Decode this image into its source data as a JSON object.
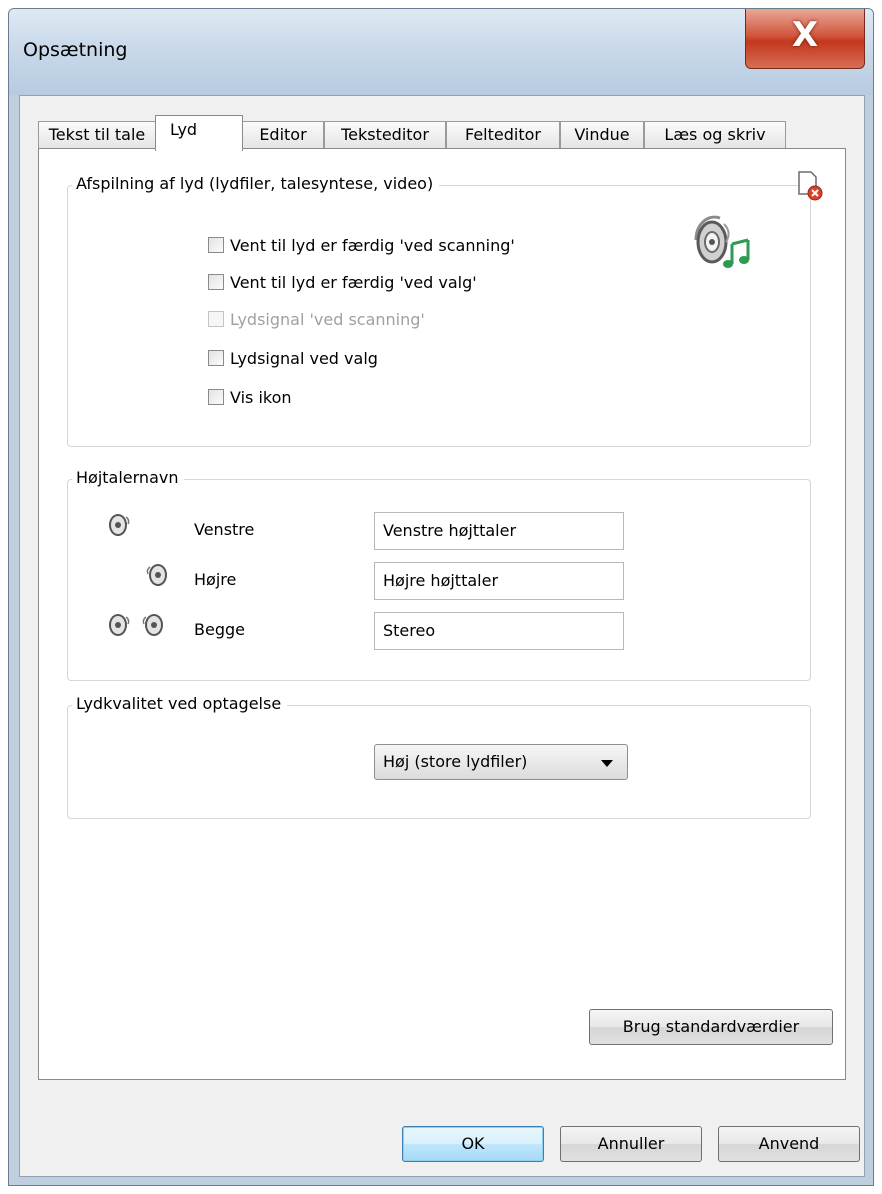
{
  "window": {
    "title": "Opsætning",
    "close_label": "X"
  },
  "tabs": [
    {
      "label": "Tekst til tale",
      "active": false
    },
    {
      "label": "Lyd",
      "active": true
    },
    {
      "label": "Editor",
      "active": false
    },
    {
      "label": "Teksteditor",
      "active": false
    },
    {
      "label": "Felteditor",
      "active": false
    },
    {
      "label": "Vindue",
      "active": false
    },
    {
      "label": "Læs og skriv",
      "active": false
    }
  ],
  "playback": {
    "title": "Afspilning af lyd (lydfiler, talesyntese, video)",
    "options": [
      {
        "label": "Vent til lyd er færdig 'ved scanning'",
        "checked": false,
        "enabled": true
      },
      {
        "label": "Vent til lyd er færdig 'ved valg'",
        "checked": false,
        "enabled": true
      },
      {
        "label": "Lydsignal 'ved scanning'",
        "checked": false,
        "enabled": false
      },
      {
        "label": "Lydsignal ved valg",
        "checked": false,
        "enabled": true
      },
      {
        "label": "Vis ikon",
        "checked": false,
        "enabled": true
      }
    ],
    "icons": {
      "corner": "disable-sound-icon",
      "main": "speaker-music-icon"
    }
  },
  "speakers": {
    "title": "Højtalernavn",
    "rows": [
      {
        "icon": "speaker-left-icon",
        "label": "Venstre",
        "value": "Venstre højttaler"
      },
      {
        "icon": "speaker-right-icon",
        "label": "Højre",
        "value": "Højre højttaler"
      },
      {
        "icon": "speaker-both-icon",
        "label": "Begge",
        "value": "Stereo"
      }
    ]
  },
  "quality": {
    "title": "Lydkvalitet ved optagelse",
    "selected": "Høj (store lydfiler)"
  },
  "buttons": {
    "defaults": "Brug standardværdier",
    "ok": "OK",
    "cancel": "Annuller",
    "apply": "Anvend"
  },
  "colors": {
    "accent": "#3c7fb1",
    "close": "#c3381e",
    "music_note": "#2e9b52"
  }
}
